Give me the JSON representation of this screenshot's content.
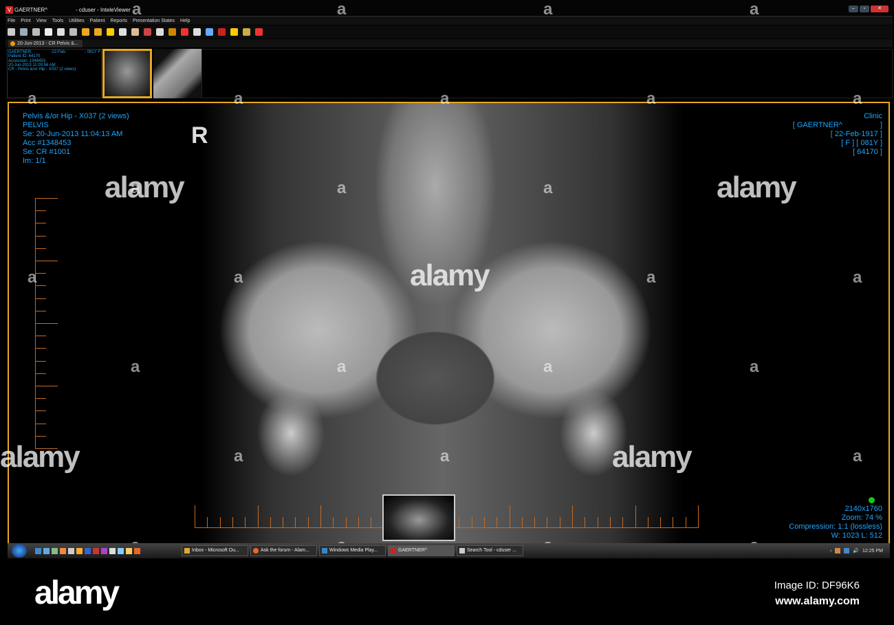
{
  "window": {
    "title_patient": "GAERTNER^",
    "title_app": "- cduser - InteleViewer",
    "logo": "V"
  },
  "menu": [
    "File",
    "Print",
    "View",
    "Tools",
    "Utilities",
    "Patient",
    "Reports",
    "Presentation States",
    "Help"
  ],
  "toolbar_icons": [
    "zoom-icon",
    "series-icon",
    "window-level-icon",
    "invert-icon",
    "pan-icon",
    "magnify-icon",
    "fit-icon",
    "cine-icon",
    "measure-icon",
    "annotate-icon",
    "align-icon",
    "layout-icon",
    "line-icon",
    "shutter-icon",
    "grid-layout-icon",
    "series-layout-icon",
    "monitor-icon",
    "more-icon",
    "key-image-icon",
    "compare-icon",
    "close-study-icon"
  ],
  "tab": {
    "label": "20-Jun-2013 - CR Pelvis &..."
  },
  "study": {
    "name": "GAERTNER,",
    "dob": "-22-Feb-",
    "age_sex": "- 081Y F",
    "patient_id": "Patient ID: 64170",
    "accession": "Accession: 1348453",
    "datetime": "20-Jun-2013 11:00:56 AM",
    "description": "CR - Pelvis &/or Hip - X037 (2 views)"
  },
  "overlay": {
    "top_left": [
      "Pelvis &/or Hip - X037 (2 views)",
      "PELVIS",
      "Se: 20-Jun-2013 11:04:13 AM",
      "Acc #1348453",
      "Se: CR #1001",
      "Im: 1/1"
    ],
    "top_right": [
      "Clinic",
      "[ GAERTNER^                  ]",
      "[ 22-Feb-1917 ]",
      "[ F ] [ 081Y ]",
      "[ 64170 ]"
    ],
    "bottom_right": [
      "2140x1760",
      "Zoom: 74 %",
      "Compression: 1:1 (lossless)",
      "W: 1023 L: 512"
    ],
    "marker": "R"
  },
  "taskbar": {
    "items": [
      "Inbox - Microsoft Ou...",
      "Ask the forum - Alam...",
      "Windows Media Play...",
      "GAERTNER^",
      "Search Tool - cduser ..."
    ],
    "clock": "12:25 PM"
  },
  "watermark": {
    "text": "alamy",
    "letter": "a"
  },
  "footer": {
    "logo": "alamy",
    "image_id": "Image ID: DF96K6",
    "url": "www.alamy.com"
  }
}
